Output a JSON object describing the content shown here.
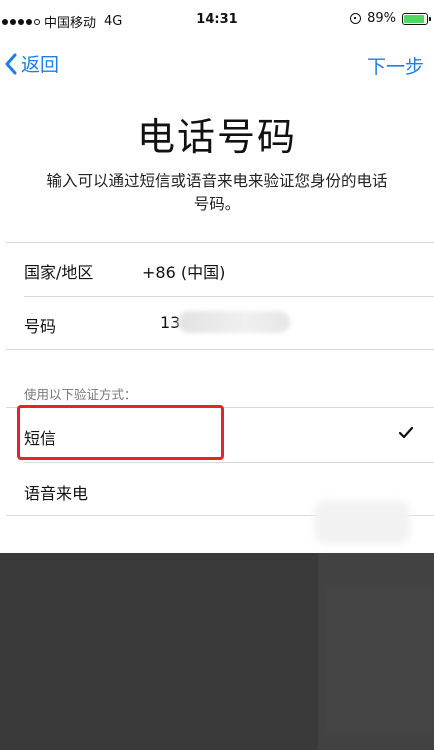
{
  "status_bar": {
    "carrier": "中国移动",
    "network": "4G",
    "time": "14:31",
    "battery": "89%",
    "battery_level": 0.89,
    "signal_bars_filled": 4,
    "signal_bars_total": 5
  },
  "nav": {
    "back_label": "返回",
    "next_label": "下一步"
  },
  "title": "电话号码",
  "description": "输入可以通过短信或语音来电来验证您身份的电话号码。",
  "fields": {
    "country_label": "国家/地区",
    "country_value": "+86 (中国)",
    "phone_label": "号码",
    "phone_value": "13"
  },
  "verify": {
    "header": "使用以下验证方式：",
    "options": [
      {
        "label": "短信",
        "selected": true
      },
      {
        "label": "语音来电",
        "selected": false
      }
    ]
  },
  "colors": {
    "accent": "#1a7fe6",
    "highlight": "#e0262b",
    "battery": "#4cd964"
  },
  "icons": {
    "back": "chevron-left-icon",
    "check": "checkmark-icon",
    "rotation_lock": "rotation-lock-icon",
    "battery": "battery-icon"
  }
}
